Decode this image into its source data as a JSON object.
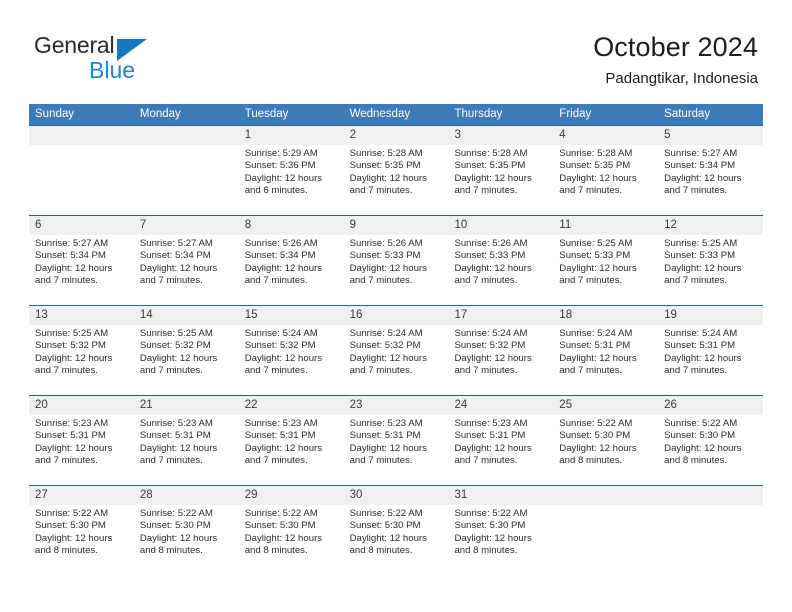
{
  "brand": {
    "word_top": "General",
    "word_bottom": "Blue",
    "accent_dark": "#1878be",
    "accent_light": "#1b86d4"
  },
  "header": {
    "title": "October 2024",
    "subtitle": "Padangtikar, Indonesia"
  },
  "theme": {
    "header_blue": "#3b7cb8",
    "row_divider_blue": "#2a6096",
    "day_number_band": "#f0f0f0"
  },
  "weekday_headers": [
    "Sunday",
    "Monday",
    "Tuesday",
    "Wednesday",
    "Thursday",
    "Friday",
    "Saturday"
  ],
  "weeks": [
    {
      "numbers": [
        "",
        "",
        "1",
        "2",
        "3",
        "4",
        "5"
      ],
      "cells": [
        {
          "l1": "",
          "l2": "",
          "l3": "",
          "l4": ""
        },
        {
          "l1": "",
          "l2": "",
          "l3": "",
          "l4": ""
        },
        {
          "l1": "Sunrise: 5:29 AM",
          "l2": "Sunset: 5:36 PM",
          "l3": "Daylight: 12 hours",
          "l4": "and 6 minutes."
        },
        {
          "l1": "Sunrise: 5:28 AM",
          "l2": "Sunset: 5:35 PM",
          "l3": "Daylight: 12 hours",
          "l4": "and 7 minutes."
        },
        {
          "l1": "Sunrise: 5:28 AM",
          "l2": "Sunset: 5:35 PM",
          "l3": "Daylight: 12 hours",
          "l4": "and 7 minutes."
        },
        {
          "l1": "Sunrise: 5:28 AM",
          "l2": "Sunset: 5:35 PM",
          "l3": "Daylight: 12 hours",
          "l4": "and 7 minutes."
        },
        {
          "l1": "Sunrise: 5:27 AM",
          "l2": "Sunset: 5:34 PM",
          "l3": "Daylight: 12 hours",
          "l4": "and 7 minutes."
        }
      ]
    },
    {
      "numbers": [
        "6",
        "7",
        "8",
        "9",
        "10",
        "11",
        "12"
      ],
      "cells": [
        {
          "l1": "Sunrise: 5:27 AM",
          "l2": "Sunset: 5:34 PM",
          "l3": "Daylight: 12 hours",
          "l4": "and 7 minutes."
        },
        {
          "l1": "Sunrise: 5:27 AM",
          "l2": "Sunset: 5:34 PM",
          "l3": "Daylight: 12 hours",
          "l4": "and 7 minutes."
        },
        {
          "l1": "Sunrise: 5:26 AM",
          "l2": "Sunset: 5:34 PM",
          "l3": "Daylight: 12 hours",
          "l4": "and 7 minutes."
        },
        {
          "l1": "Sunrise: 5:26 AM",
          "l2": "Sunset: 5:33 PM",
          "l3": "Daylight: 12 hours",
          "l4": "and 7 minutes."
        },
        {
          "l1": "Sunrise: 5:26 AM",
          "l2": "Sunset: 5:33 PM",
          "l3": "Daylight: 12 hours",
          "l4": "and 7 minutes."
        },
        {
          "l1": "Sunrise: 5:25 AM",
          "l2": "Sunset: 5:33 PM",
          "l3": "Daylight: 12 hours",
          "l4": "and 7 minutes."
        },
        {
          "l1": "Sunrise: 5:25 AM",
          "l2": "Sunset: 5:33 PM",
          "l3": "Daylight: 12 hours",
          "l4": "and 7 minutes."
        }
      ]
    },
    {
      "numbers": [
        "13",
        "14",
        "15",
        "16",
        "17",
        "18",
        "19"
      ],
      "cells": [
        {
          "l1": "Sunrise: 5:25 AM",
          "l2": "Sunset: 5:32 PM",
          "l3": "Daylight: 12 hours",
          "l4": "and 7 minutes."
        },
        {
          "l1": "Sunrise: 5:25 AM",
          "l2": "Sunset: 5:32 PM",
          "l3": "Daylight: 12 hours",
          "l4": "and 7 minutes."
        },
        {
          "l1": "Sunrise: 5:24 AM",
          "l2": "Sunset: 5:32 PM",
          "l3": "Daylight: 12 hours",
          "l4": "and 7 minutes."
        },
        {
          "l1": "Sunrise: 5:24 AM",
          "l2": "Sunset: 5:32 PM",
          "l3": "Daylight: 12 hours",
          "l4": "and 7 minutes."
        },
        {
          "l1": "Sunrise: 5:24 AM",
          "l2": "Sunset: 5:32 PM",
          "l3": "Daylight: 12 hours",
          "l4": "and 7 minutes."
        },
        {
          "l1": "Sunrise: 5:24 AM",
          "l2": "Sunset: 5:31 PM",
          "l3": "Daylight: 12 hours",
          "l4": "and 7 minutes."
        },
        {
          "l1": "Sunrise: 5:24 AM",
          "l2": "Sunset: 5:31 PM",
          "l3": "Daylight: 12 hours",
          "l4": "and 7 minutes."
        }
      ]
    },
    {
      "numbers": [
        "20",
        "21",
        "22",
        "23",
        "24",
        "25",
        "26"
      ],
      "cells": [
        {
          "l1": "Sunrise: 5:23 AM",
          "l2": "Sunset: 5:31 PM",
          "l3": "Daylight: 12 hours",
          "l4": "and 7 minutes."
        },
        {
          "l1": "Sunrise: 5:23 AM",
          "l2": "Sunset: 5:31 PM",
          "l3": "Daylight: 12 hours",
          "l4": "and 7 minutes."
        },
        {
          "l1": "Sunrise: 5:23 AM",
          "l2": "Sunset: 5:31 PM",
          "l3": "Daylight: 12 hours",
          "l4": "and 7 minutes."
        },
        {
          "l1": "Sunrise: 5:23 AM",
          "l2": "Sunset: 5:31 PM",
          "l3": "Daylight: 12 hours",
          "l4": "and 7 minutes."
        },
        {
          "l1": "Sunrise: 5:23 AM",
          "l2": "Sunset: 5:31 PM",
          "l3": "Daylight: 12 hours",
          "l4": "and 7 minutes."
        },
        {
          "l1": "Sunrise: 5:22 AM",
          "l2": "Sunset: 5:30 PM",
          "l3": "Daylight: 12 hours",
          "l4": "and 8 minutes."
        },
        {
          "l1": "Sunrise: 5:22 AM",
          "l2": "Sunset: 5:30 PM",
          "l3": "Daylight: 12 hours",
          "l4": "and 8 minutes."
        }
      ]
    },
    {
      "numbers": [
        "27",
        "28",
        "29",
        "30",
        "31",
        "",
        ""
      ],
      "cells": [
        {
          "l1": "Sunrise: 5:22 AM",
          "l2": "Sunset: 5:30 PM",
          "l3": "Daylight: 12 hours",
          "l4": "and 8 minutes."
        },
        {
          "l1": "Sunrise: 5:22 AM",
          "l2": "Sunset: 5:30 PM",
          "l3": "Daylight: 12 hours",
          "l4": "and 8 minutes."
        },
        {
          "l1": "Sunrise: 5:22 AM",
          "l2": "Sunset: 5:30 PM",
          "l3": "Daylight: 12 hours",
          "l4": "and 8 minutes."
        },
        {
          "l1": "Sunrise: 5:22 AM",
          "l2": "Sunset: 5:30 PM",
          "l3": "Daylight: 12 hours",
          "l4": "and 8 minutes."
        },
        {
          "l1": "Sunrise: 5:22 AM",
          "l2": "Sunset: 5:30 PM",
          "l3": "Daylight: 12 hours",
          "l4": "and 8 minutes."
        },
        {
          "l1": "",
          "l2": "",
          "l3": "",
          "l4": ""
        },
        {
          "l1": "",
          "l2": "",
          "l3": "",
          "l4": ""
        }
      ]
    }
  ]
}
